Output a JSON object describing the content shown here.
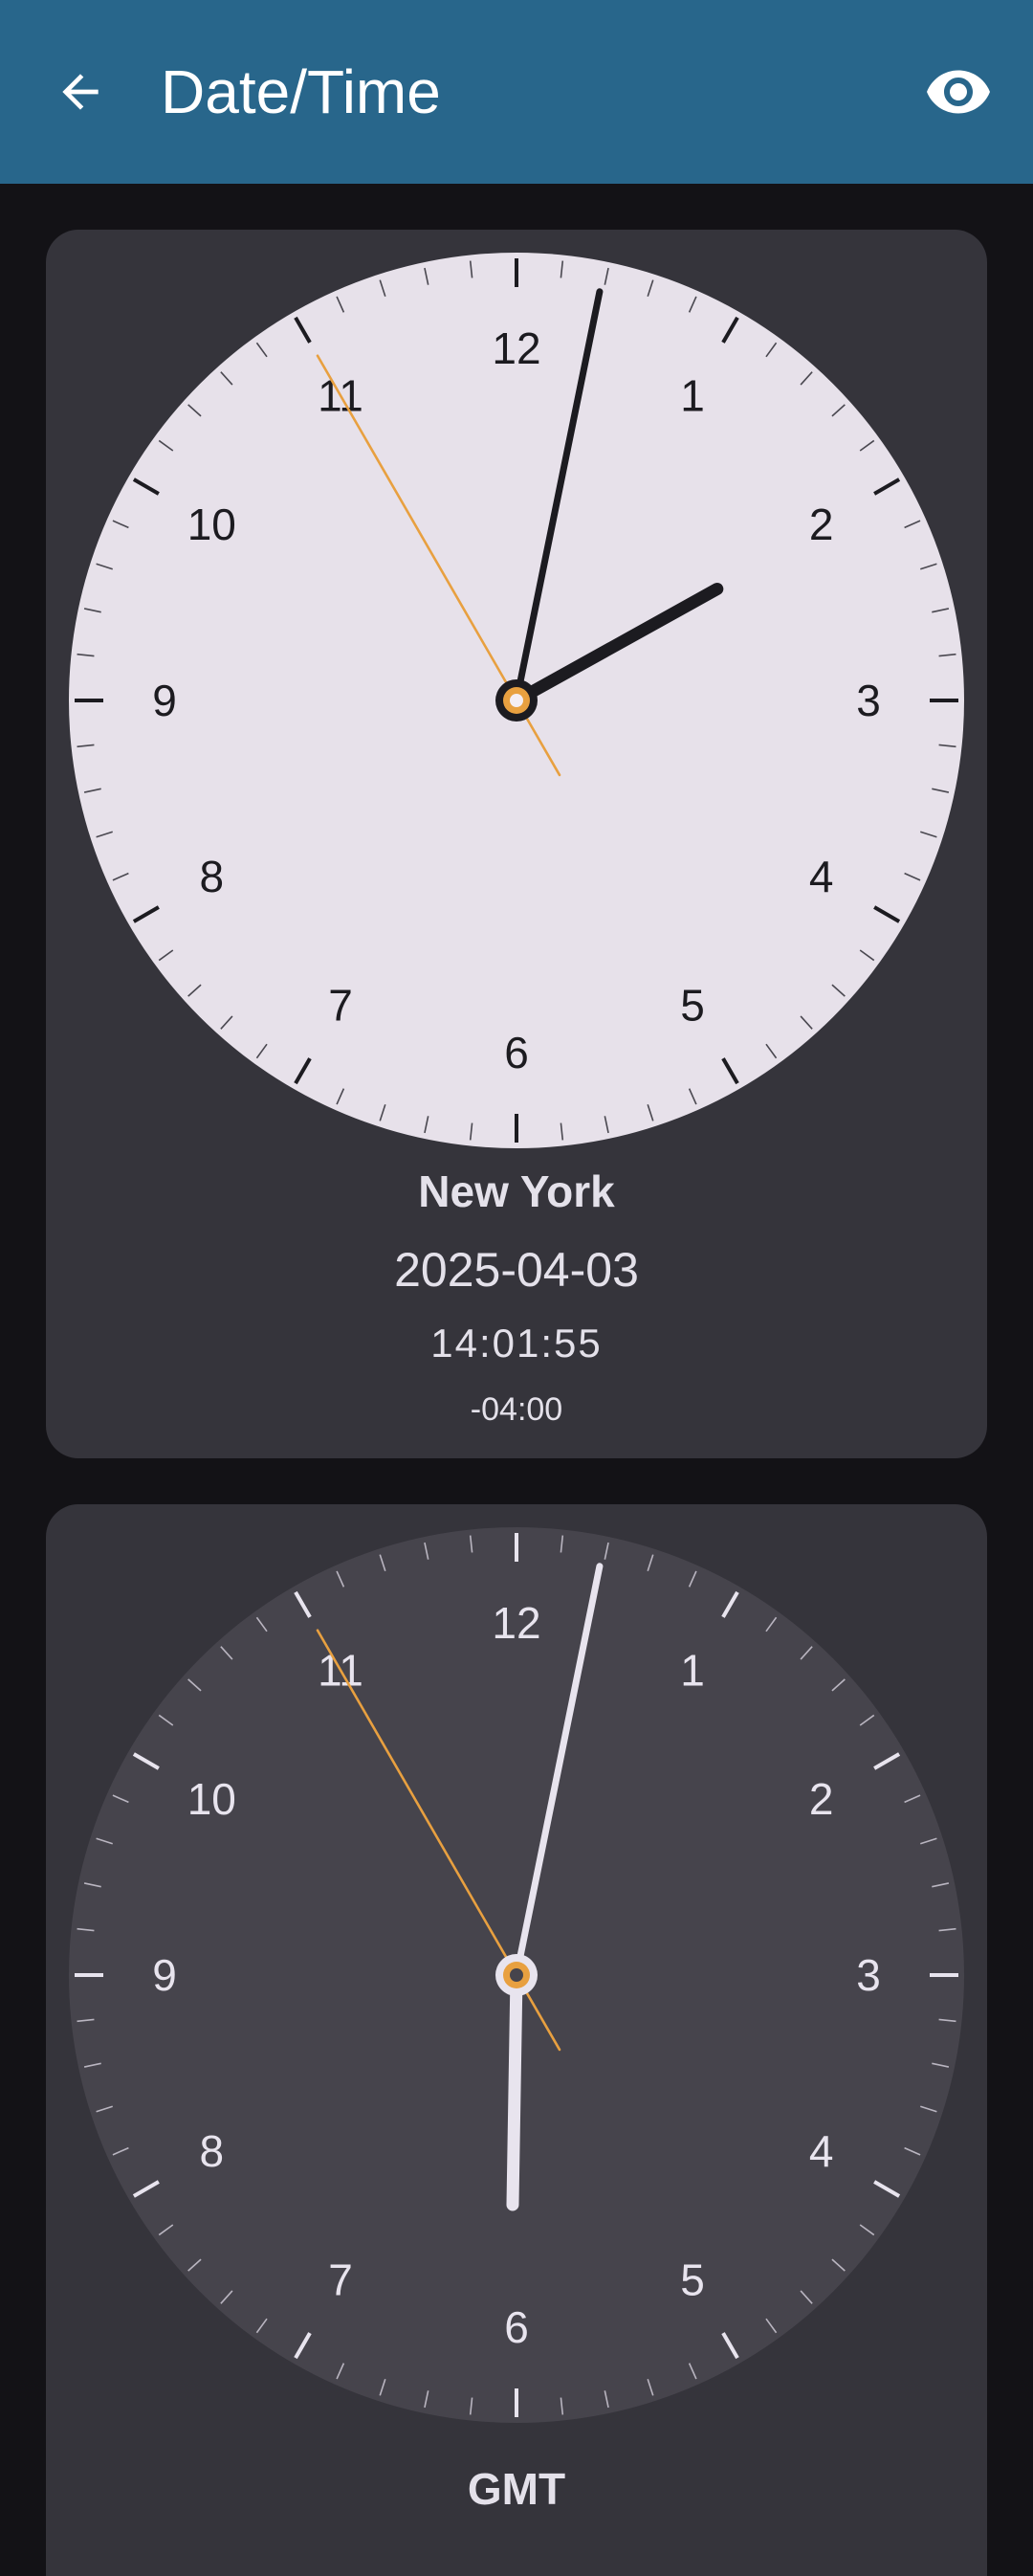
{
  "app_bar": {
    "title": "Date/Time",
    "back_icon": "arrow-back-icon",
    "visibility_icon": "eye-icon",
    "background": "#28668b"
  },
  "clocks": [
    {
      "city": "New York",
      "date": "2025-04-03",
      "time": "14:01:55",
      "offset": "-04:00",
      "hour": 14,
      "minute": 1,
      "second": 55,
      "theme": "light",
      "numbers": [
        "12",
        "1",
        "2",
        "3",
        "4",
        "5",
        "6",
        "7",
        "8",
        "9",
        "10",
        "11"
      ]
    },
    {
      "city": "GMT",
      "hour": 18,
      "minute": 1,
      "second": 55,
      "theme": "dark",
      "numbers": [
        "12",
        "1",
        "2",
        "3",
        "4",
        "5",
        "6",
        "7",
        "8",
        "9",
        "10",
        "11"
      ]
    }
  ],
  "colors": {
    "second_hand": "#e8a040",
    "light_face": "#e7e1ea",
    "dark_face": "#46444c",
    "card": "#35343b",
    "page": "#131216"
  }
}
